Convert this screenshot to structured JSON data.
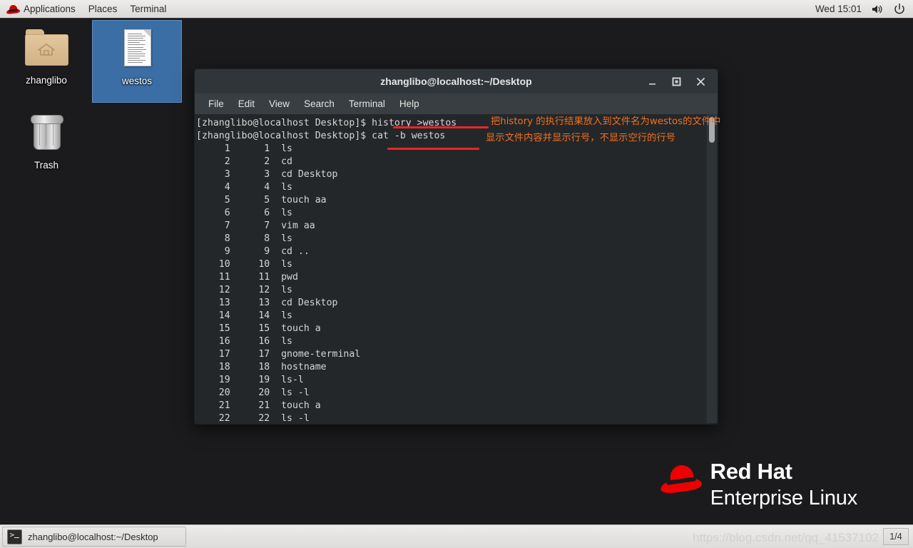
{
  "top_panel": {
    "logo_icon": "redhat-fedora-icon",
    "menus": [
      {
        "label": "Applications"
      },
      {
        "label": "Places"
      },
      {
        "label": "Terminal"
      }
    ],
    "clock": "Wed 15:01",
    "volume_icon": "volume-icon",
    "power_icon": "power-icon"
  },
  "desktop": {
    "background_color": "#1b1b1d",
    "icons": [
      {
        "name": "zhanglibo",
        "label": "zhanglibo",
        "type": "folder",
        "selected": false
      },
      {
        "name": "westos",
        "label": "westos",
        "type": "document",
        "selected": true
      },
      {
        "name": "trash",
        "label": "Trash",
        "type": "trash",
        "selected": false
      }
    ],
    "selection_color": "#3b6ea5",
    "brand": {
      "line1": "Red Hat",
      "line2": "Enterprise Linux",
      "logo_icon": "redhat-fedora-icon",
      "accent_color": "#ee0000"
    }
  },
  "terminal": {
    "title": "zhanglibo@localhost:~/Desktop",
    "window_buttons": {
      "minimize": "_",
      "maximize": "❐",
      "close": "✕"
    },
    "menubar": [
      "File",
      "Edit",
      "View",
      "Search",
      "Terminal",
      "Help"
    ],
    "background_color": "#242729",
    "foreground_color": "#d6d6d6",
    "prompt": "[zhanglibo@localhost Desktop]$ ",
    "commands": [
      {
        "prompt": "[zhanglibo@localhost Desktop]$ ",
        "command": "history >westos"
      },
      {
        "prompt": "[zhanglibo@localhost Desktop]$ ",
        "command": "cat -b westos"
      }
    ],
    "output_rows": [
      {
        "line": "1",
        "hist": "1",
        "cmd": "ls"
      },
      {
        "line": "2",
        "hist": "2",
        "cmd": "cd"
      },
      {
        "line": "3",
        "hist": "3",
        "cmd": "cd Desktop"
      },
      {
        "line": "4",
        "hist": "4",
        "cmd": "ls"
      },
      {
        "line": "5",
        "hist": "5",
        "cmd": "touch aa"
      },
      {
        "line": "6",
        "hist": "6",
        "cmd": "ls"
      },
      {
        "line": "7",
        "hist": "7",
        "cmd": "vim aa"
      },
      {
        "line": "8",
        "hist": "8",
        "cmd": "ls"
      },
      {
        "line": "9",
        "hist": "9",
        "cmd": "cd .."
      },
      {
        "line": "10",
        "hist": "10",
        "cmd": "ls"
      },
      {
        "line": "11",
        "hist": "11",
        "cmd": "pwd"
      },
      {
        "line": "12",
        "hist": "12",
        "cmd": "ls"
      },
      {
        "line": "13",
        "hist": "13",
        "cmd": "cd Desktop"
      },
      {
        "line": "14",
        "hist": "14",
        "cmd": "ls"
      },
      {
        "line": "15",
        "hist": "15",
        "cmd": "touch a"
      },
      {
        "line": "16",
        "hist": "16",
        "cmd": "ls"
      },
      {
        "line": "17",
        "hist": "17",
        "cmd": "gnome-terminal"
      },
      {
        "line": "18",
        "hist": "18",
        "cmd": "hostname"
      },
      {
        "line": "19",
        "hist": "19",
        "cmd": "ls-l"
      },
      {
        "line": "20",
        "hist": "20",
        "cmd": "ls -l"
      },
      {
        "line": "21",
        "hist": "21",
        "cmd": "touch a"
      },
      {
        "line": "22",
        "hist": "22",
        "cmd": "ls -l"
      }
    ],
    "scrollbar": {
      "name": "vertical-scrollbar",
      "thumb_position": "top"
    }
  },
  "annotations": {
    "color": "#f07020",
    "underline_color": "#e8262a",
    "notes": [
      {
        "id": "note-history",
        "text": "把history 的执行结果放入到文件名为westos的文件中"
      },
      {
        "id": "note-cat",
        "text": "显示文件内容并显示行号，不显示空行的行号"
      }
    ]
  },
  "bottom_panel": {
    "task_button": {
      "label": "zhanglibo@localhost:~/Desktop",
      "icon": "terminal-icon"
    },
    "watermark": "https://blog.csdn.net/qq_41537102",
    "workspace": "1/4"
  }
}
